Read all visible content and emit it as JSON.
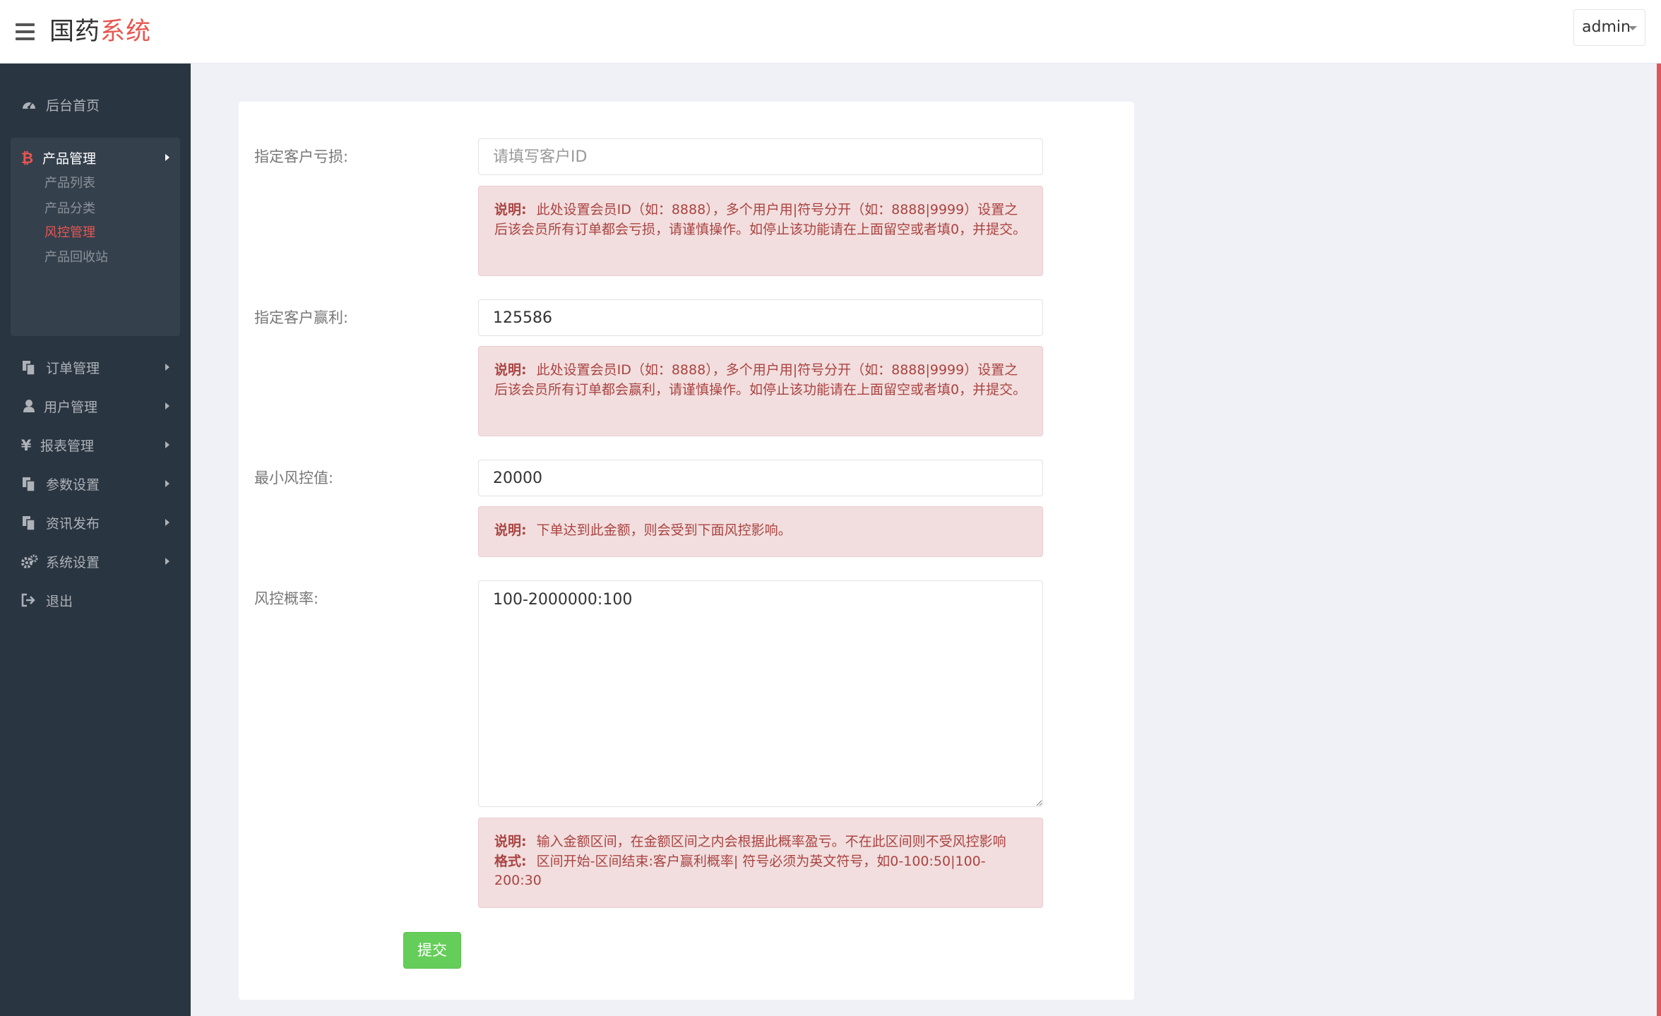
{
  "header": {
    "brand_part1": "国药",
    "brand_part2": "系统",
    "user_name": "admin"
  },
  "sidebar": {
    "items": [
      {
        "label": "后台首页",
        "icon": "dashboard-icon"
      },
      {
        "label": "产品管理",
        "icon": "bitcoin-icon",
        "expanded": true,
        "children": [
          "产品列表",
          "产品分类",
          "风控管理",
          "产品回收站"
        ],
        "active_child": "风控管理"
      },
      {
        "label": "订单管理",
        "icon": "copy-icon"
      },
      {
        "label": "用户管理",
        "icon": "user-icon"
      },
      {
        "label": "报表管理",
        "icon": "yen-icon"
      },
      {
        "label": "参数设置",
        "icon": "copy-icon"
      },
      {
        "label": "资讯发布",
        "icon": "copy-icon"
      },
      {
        "label": "系统设置",
        "icon": "gears-icon"
      },
      {
        "label": "退出",
        "icon": "sign-out-icon"
      }
    ]
  },
  "form": {
    "loss_label": "指定客户亏损:",
    "loss_placeholder": "请填写客户ID",
    "loss_value": "",
    "loss_note_title": "说明:",
    "loss_note_text": "此处设置会员ID（如：8888），多个用户用|符号分开（如：8888|9999）设置之后该会员所有订单都会亏损，请谨慎操作。如停止该功能请在上面留空或者填0，并提交。",
    "win_label": "指定客户赢利:",
    "win_value": "125586",
    "win_note_title": "说明:",
    "win_note_text": "此处设置会员ID（如：8888），多个用户用|符号分开（如：8888|9999）设置之后该会员所有订单都会赢利，请谨慎操作。如停止该功能请在上面留空或者填0，并提交。",
    "min_label": "最小风控值:",
    "min_value": "20000",
    "min_note_title": "说明:",
    "min_note_text": "下单达到此金额，则会受到下面风控影响。",
    "rate_label": "风控概率:",
    "rate_value": "100-2000000:100",
    "rate_note_title": "说明:",
    "rate_note_text": "输入金额区间，在金额区间之内会根据此概率盈亏。不在此区间则不受风控影响",
    "rate_format_title": "格式:",
    "rate_format_text": "区间开始-区间结束:客户赢利概率|        符号必须为英文符号，如0-100:50|100-200:30",
    "submit_label": "提交"
  },
  "colors": {
    "accent": "#e8564f",
    "sidebar_bg": "#2a3542",
    "note_bg": "#f2dede",
    "note_text": "#a94442",
    "submit_bg": "#65cd5a"
  }
}
